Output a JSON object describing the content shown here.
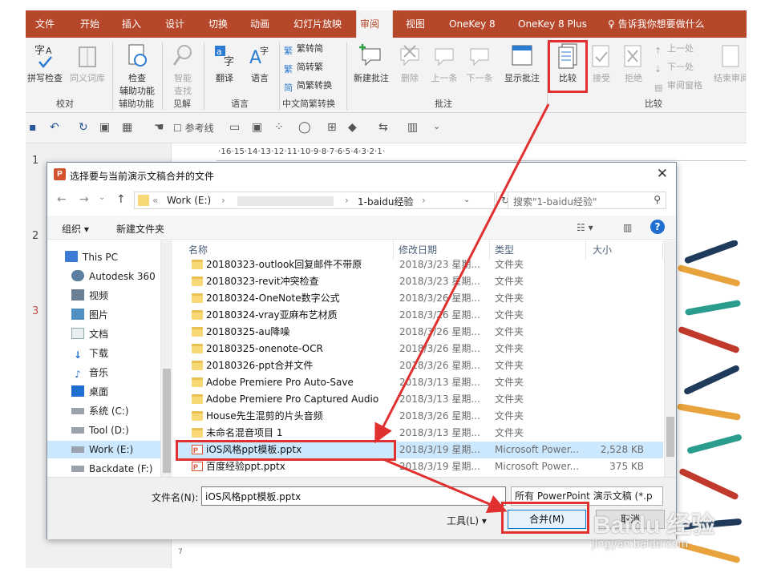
{
  "ribbon_tabs": [
    "文件",
    "开始",
    "插入",
    "设计",
    "切换",
    "动画",
    "幻灯片放映",
    "审阅",
    "视图",
    "OneKey 8",
    "OneKey 8 Plus"
  ],
  "tell_me": "告诉我你想要做什么",
  "ribbon": {
    "proofing": {
      "spell": "拼写检查",
      "thesaurus": "同义词库",
      "group": "校对"
    },
    "accessibility": {
      "check": "检查",
      "check2": "辅助功能",
      "group": "辅助功能"
    },
    "insights": {
      "smart": "智能",
      "smart2": "查找",
      "group": "见解"
    },
    "language": {
      "translate": "翻译",
      "language": "语言",
      "group": "语言"
    },
    "chinese": {
      "t2s": "繁转简",
      "s2t": "简转繁",
      "convert": "简繁转换",
      "group": "中文简繁转换"
    },
    "comments": {
      "new": "新建批注",
      "delete": "删除",
      "prev": "上一条",
      "next": "下一条",
      "show": "显示批注",
      "group": "批注"
    },
    "compare": {
      "compare": "比较",
      "accept": "接受",
      "reject": "拒绝",
      "prev": "上一处",
      "next": "下一处",
      "pane": "审阅窗格",
      "end": "结束审阅",
      "group": "比较"
    }
  },
  "qat": {
    "ref_line": "参考线"
  },
  "slide_numbers": [
    "1",
    "2",
    "3"
  ],
  "ruler_text": "·16·15·14·13·12·11·10·9·8·7·6·5·4·3·2·1·",
  "vruler_text": "7",
  "dialog": {
    "title": "选择要与当前演示文稿合并的文件",
    "address": {
      "root": "Work (E:)",
      "folder": "1-baidu经验"
    },
    "search_placeholder": "搜索\"1-baidu经验\"",
    "organize": "组织 ▾",
    "new_folder": "新建文件夹",
    "nav_items": [
      {
        "label": "This PC",
        "icon": "computer-icon"
      },
      {
        "label": "Autodesk 360",
        "icon": "cloud-icon"
      },
      {
        "label": "视频",
        "icon": "video-folder-icon"
      },
      {
        "label": "图片",
        "icon": "pictures-folder-icon"
      },
      {
        "label": "文档",
        "icon": "documents-folder-icon"
      },
      {
        "label": "下载",
        "icon": "download-icon"
      },
      {
        "label": "音乐",
        "icon": "music-icon"
      },
      {
        "label": "桌面",
        "icon": "desktop-icon"
      },
      {
        "label": "系统 (C:)",
        "icon": "drive-icon"
      },
      {
        "label": "Tool (D:)",
        "icon": "drive-icon"
      },
      {
        "label": "Work (E:)",
        "icon": "drive-icon"
      },
      {
        "label": "Backdate (F:)",
        "icon": "drive-icon"
      }
    ],
    "columns": {
      "name": "名称",
      "date": "修改日期",
      "type": "类型",
      "size": "大小"
    },
    "files": [
      {
        "name": "20180323-outlook回复邮件不带原",
        "date": "2018/3/23 星期...",
        "type": "文件夹",
        "size": "",
        "kind": "folder"
      },
      {
        "name": "20180323-revit冲突检查",
        "date": "2018/3/23 星期...",
        "type": "文件夹",
        "size": "",
        "kind": "folder"
      },
      {
        "name": "20180324-OneNote数字公式",
        "date": "2018/3/26 星期...",
        "type": "文件夹",
        "size": "",
        "kind": "folder"
      },
      {
        "name": "20180324-vray亚麻布艺材质",
        "date": "2018/3/26 星期...",
        "type": "文件夹",
        "size": "",
        "kind": "folder"
      },
      {
        "name": "20180325-au降噪",
        "date": "2018/3/26 星期...",
        "type": "文件夹",
        "size": "",
        "kind": "folder"
      },
      {
        "name": "20180325-onenote-OCR",
        "date": "2018/3/26 星期...",
        "type": "文件夹",
        "size": "",
        "kind": "folder"
      },
      {
        "name": "20180326-ppt合并文件",
        "date": "2018/3/26 星期...",
        "type": "文件夹",
        "size": "",
        "kind": "folder"
      },
      {
        "name": "Adobe Premiere Pro Auto-Save",
        "date": "2018/3/13 星期...",
        "type": "文件夹",
        "size": "",
        "kind": "folder"
      },
      {
        "name": "Adobe Premiere Pro Captured Audio",
        "date": "2018/3/13 星期...",
        "type": "文件夹",
        "size": "",
        "kind": "folder"
      },
      {
        "name": "House先生混剪的片头音频",
        "date": "2018/3/26 星期...",
        "type": "文件夹",
        "size": "",
        "kind": "folder"
      },
      {
        "name": "未命名混音项目 1",
        "date": "2018/3/13 星期...",
        "type": "文件夹",
        "size": "",
        "kind": "folder"
      },
      {
        "name": "iOS风格ppt模板.pptx",
        "date": "2018/3/19 星期...",
        "type": "Microsoft Power...",
        "size": "2,528 KB",
        "kind": "pptx"
      },
      {
        "name": "百度经验ppt.pptx",
        "date": "2018/3/19 星期...",
        "type": "Microsoft Power...",
        "size": "375 KB",
        "kind": "pptx"
      }
    ],
    "filename_label": "文件名(N):",
    "filename_value": "iOS风格ppt模板.pptx",
    "filetype": "所有 PowerPoint 演示文稿 (*.p",
    "tools": "工具(L)",
    "merge": "合并(M)",
    "cancel": "取消"
  },
  "watermark": "Baidu 经验",
  "watermark_sub": "jingyan.baidu.com",
  "colors": {
    "ppt_red": "#b7472a",
    "highlight": "#e03030",
    "selection": "#cce8ff"
  }
}
